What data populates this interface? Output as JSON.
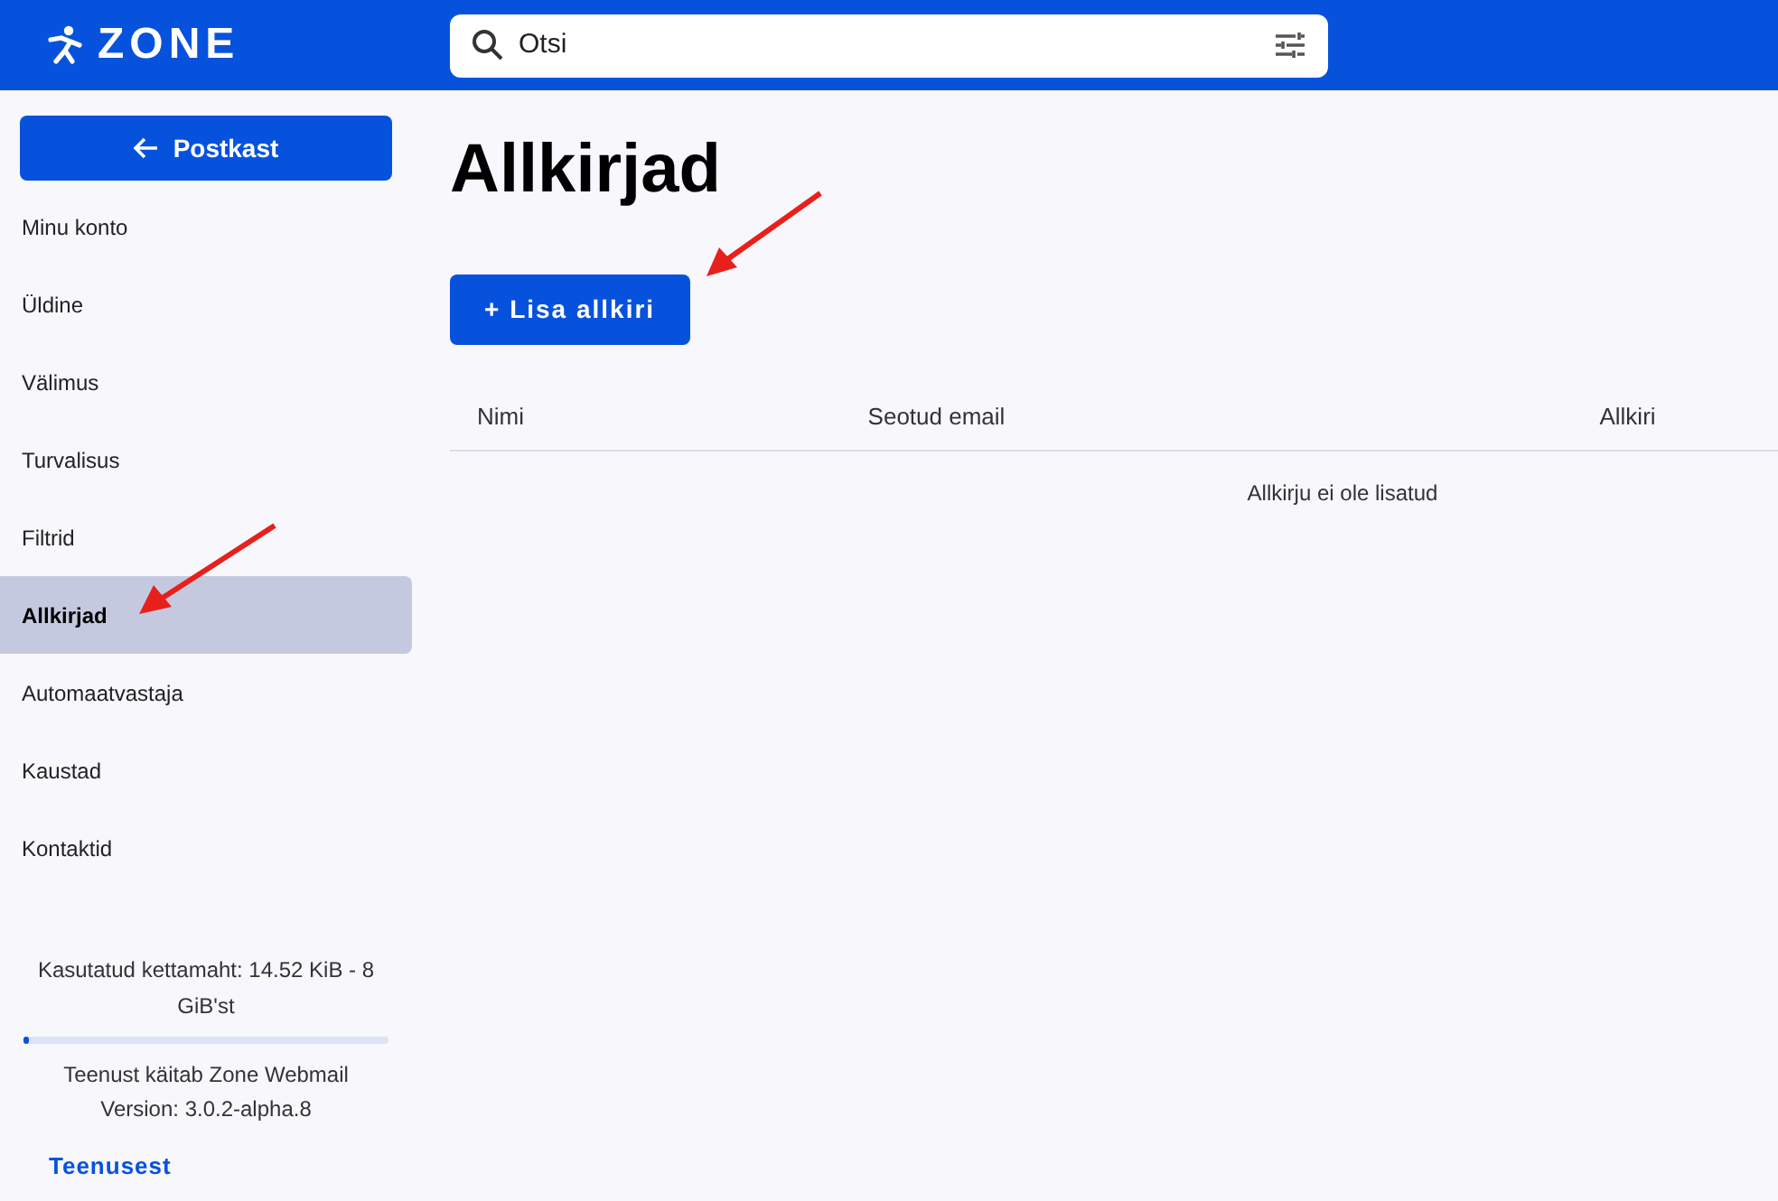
{
  "header": {
    "logo": "ZONE",
    "search": {
      "value": "Otsi"
    }
  },
  "sidebar": {
    "back_button": "Postkast",
    "items": [
      {
        "label": "Minu konto",
        "selected": false
      },
      {
        "label": "Üldine",
        "selected": false
      },
      {
        "label": "Välimus",
        "selected": false
      },
      {
        "label": "Turvalisus",
        "selected": false
      },
      {
        "label": "Filtrid",
        "selected": false
      },
      {
        "label": "Allkirjad",
        "selected": true
      },
      {
        "label": "Automaatvastaja",
        "selected": false
      },
      {
        "label": "Kaustad",
        "selected": false
      },
      {
        "label": "Kontaktid",
        "selected": false
      }
    ],
    "storage": {
      "text": "Kasutatud kettamaht: 14.52 KiB - 8 GiB'st",
      "level": 0.01
    },
    "footer": [
      "Teenust käitab Zone Webmail",
      "Version: 3.0.2-alpha.8"
    ],
    "about_link": "Teenusest"
  },
  "main": {
    "title": "Allkirjad",
    "add_button": "+ Lisa allkiri",
    "table": {
      "columns": [
        "Nimi",
        "Seotud email",
        "Allkiri"
      ],
      "empty_text": "Allkirju ei ole lisatud"
    }
  }
}
